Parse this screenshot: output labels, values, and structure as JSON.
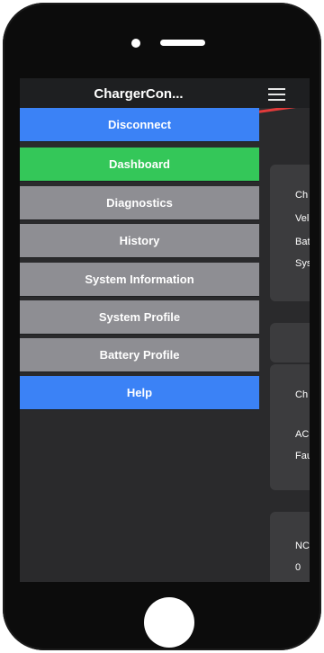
{
  "app": {
    "title": "ChargerCon..."
  },
  "menu": {
    "items": [
      {
        "label": "Disconnect",
        "style": "blue"
      },
      {
        "label": "Dashboard",
        "style": "green"
      },
      {
        "label": "Diagnostics",
        "style": "grey"
      },
      {
        "label": "History",
        "style": "grey"
      },
      {
        "label": "System Information",
        "style": "grey"
      },
      {
        "label": "System Profile",
        "style": "grey"
      },
      {
        "label": "Battery Profile",
        "style": "grey"
      },
      {
        "label": "Help",
        "style": "blue"
      }
    ]
  },
  "background_panels": {
    "panel1": {
      "rows": [
        "Ch",
        "Vel",
        "Bat",
        "Sys"
      ]
    },
    "panel2": {
      "rows": [
        "Ch",
        "AC",
        "Fau"
      ]
    },
    "panel3": {
      "rows": [
        "NC",
        "0"
      ]
    }
  },
  "colors": {
    "blue": "#3b82f6",
    "green": "#34c759",
    "grey": "#8e8e93",
    "screen_bg": "#2a2a2c",
    "accent_red": "#e23b3b"
  },
  "icons": {
    "menu": "hamburger-menu-icon"
  }
}
